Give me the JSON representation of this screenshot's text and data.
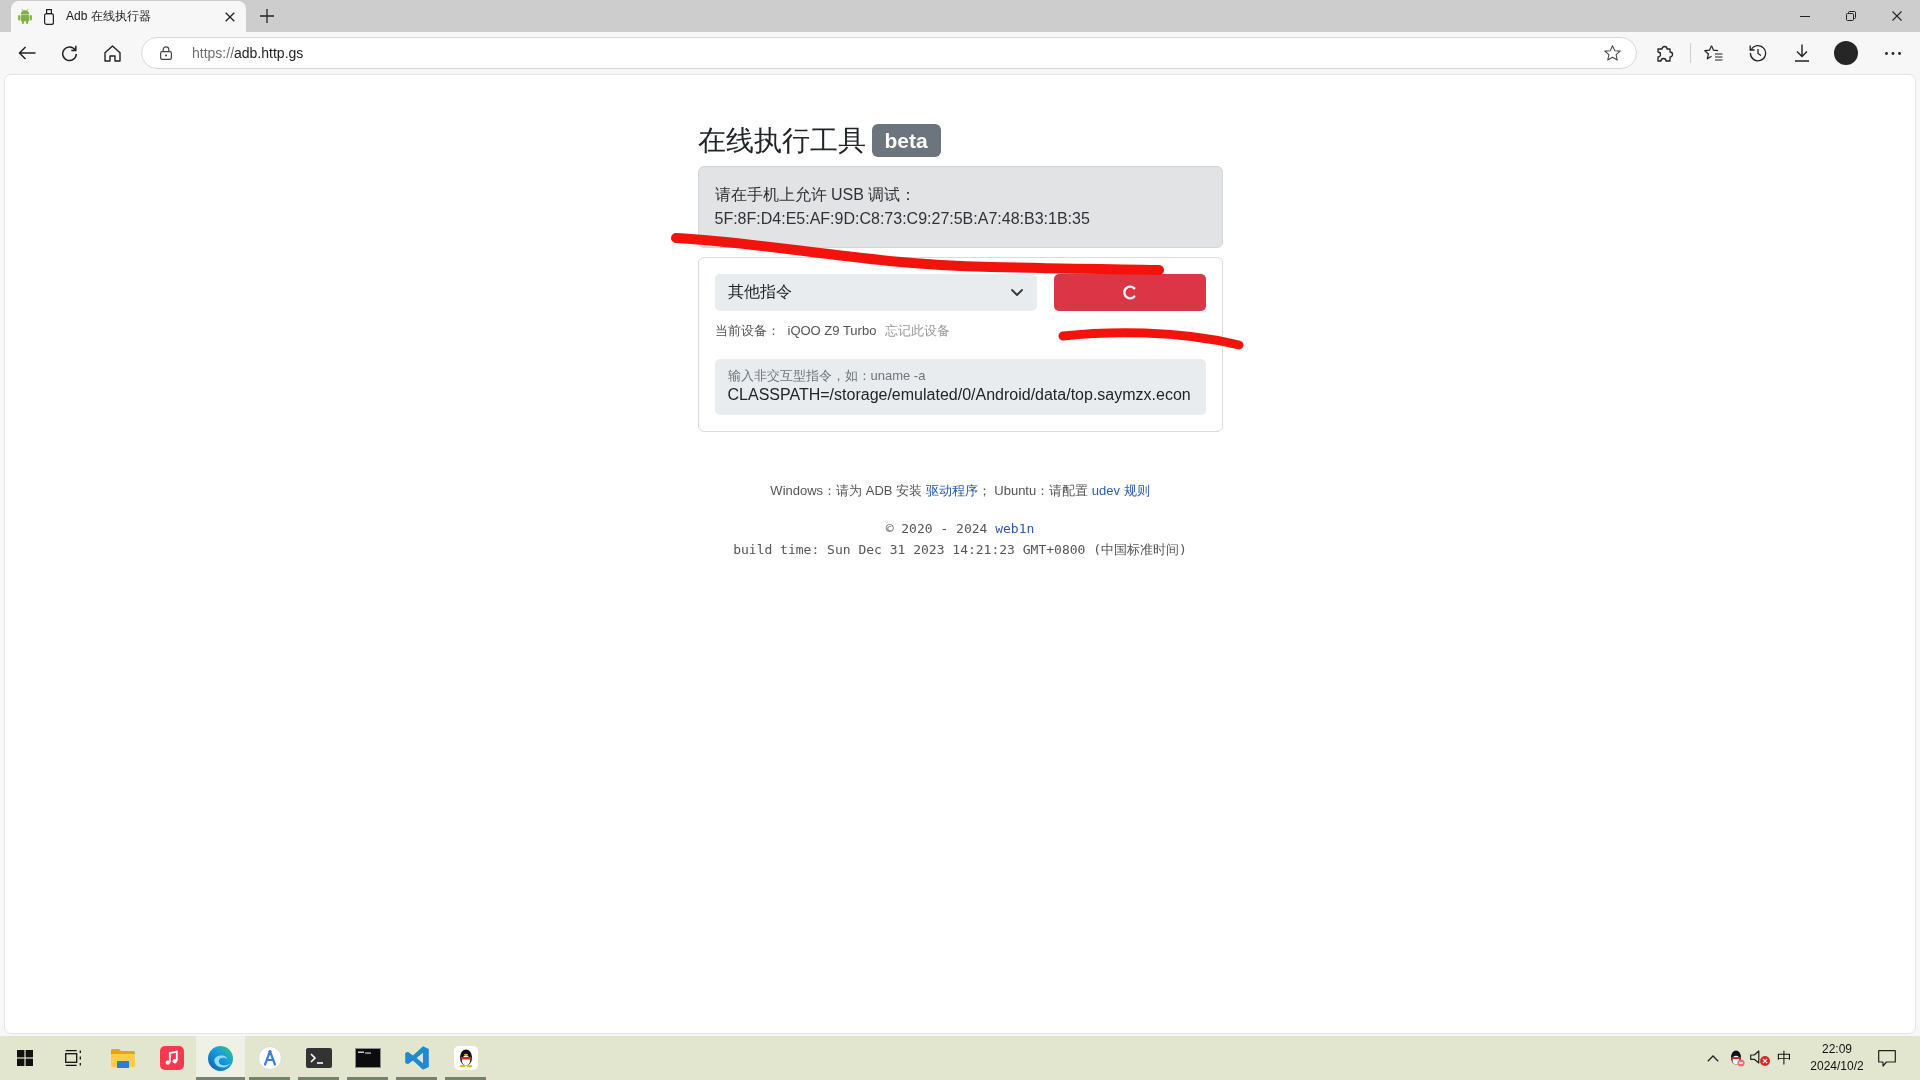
{
  "browser": {
    "tabs": [
      {
        "title": "Adb 在线执行器",
        "selected": true
      }
    ],
    "address_bar": {
      "scheme": "https://",
      "host": "adb.http.gs"
    }
  },
  "page": {
    "heading": "在线执行工具",
    "badge": "beta",
    "usb_notice": {
      "prompt": "请在手机上允许 USB 调试：",
      "fingerprint": "5F:8F:D4:E5:AF:9D:C8:73:C9:27:5B:A7:48:B3:1B:35"
    },
    "command_select": {
      "value": "其他指令"
    },
    "run_button": {
      "busy": true
    },
    "device": {
      "label": "当前设备：",
      "name": "iQOO Z9 Turbo",
      "forget_link": "忘记此设备"
    },
    "command_input": {
      "label": "输入非交互型指令，如：uname -a",
      "value": "CLASSPATH=/storage/emulated/0/Android/data/top.saymzx.econ"
    },
    "help_line": [
      {
        "kind": "text",
        "text": "Windows：请为 ADB 安装 "
      },
      {
        "kind": "link",
        "text": "驱动程序"
      },
      {
        "kind": "text",
        "text": "； Ubuntu：请配置 "
      },
      {
        "kind": "link",
        "text": "udev 规则"
      }
    ],
    "copyright": [
      {
        "kind": "text",
        "text": "© 2020 - 2024 "
      },
      {
        "kind": "link",
        "text": "web1n"
      }
    ],
    "build_time": "build time: Sun Dec 31 2023 14:21:23 GMT+0800 (中国标准时间)"
  },
  "taskbar": {
    "apps": [
      {
        "kind": "start",
        "running": false,
        "selected": false
      },
      {
        "kind": "task-view",
        "running": false,
        "selected": false
      },
      {
        "kind": "files",
        "running": false,
        "selected": false
      },
      {
        "kind": "music",
        "running": false,
        "selected": false
      },
      {
        "kind": "browser",
        "running": true,
        "selected": true
      },
      {
        "kind": "studio",
        "running": true,
        "selected": false
      },
      {
        "kind": "terminal",
        "running": true,
        "selected": false
      },
      {
        "kind": "console",
        "running": true,
        "selected": false
      },
      {
        "kind": "editor",
        "running": true,
        "selected": false
      },
      {
        "kind": "messenger",
        "running": true,
        "selected": false
      }
    ],
    "tray": {
      "volume_muted": true,
      "input_method": "中",
      "time": "22:09",
      "date": "2024/10/2"
    }
  }
}
